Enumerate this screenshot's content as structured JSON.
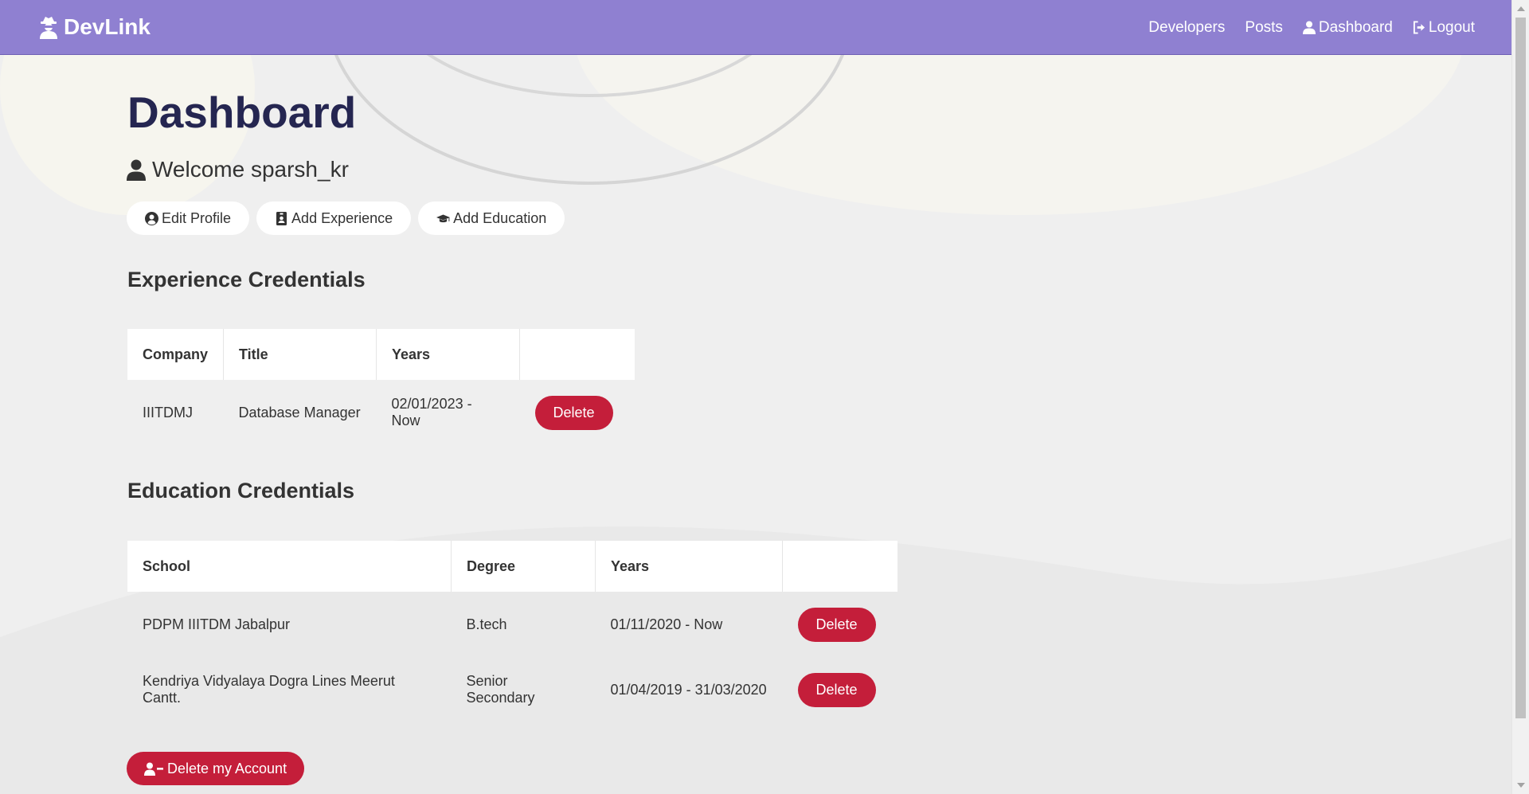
{
  "colors": {
    "navbar": "#8f80d1",
    "title": "#252651",
    "danger": "#c41e3a",
    "background": "#f1f1f1"
  },
  "navbar": {
    "brand": "DevLink",
    "brand_icon": "user-secret-icon",
    "links": [
      {
        "label": "Developers"
      },
      {
        "label": "Posts"
      },
      {
        "label": "Dashboard",
        "icon": "user-icon"
      },
      {
        "label": "Logout",
        "icon": "sign-out-icon"
      }
    ]
  },
  "page": {
    "title": "Dashboard",
    "welcome": "Welcome sparsh_kr",
    "actions": [
      {
        "label": "Edit Profile",
        "icon": "user-circle-icon"
      },
      {
        "label": "Add Experience",
        "icon": "id-badge-icon"
      },
      {
        "label": "Add Education",
        "icon": "graduation-cap-icon"
      }
    ]
  },
  "experience": {
    "heading": "Experience Credentials",
    "columns": [
      "Company",
      "Title",
      "Years",
      ""
    ],
    "rows": [
      {
        "company": "IIITDMJ",
        "title": "Database Manager",
        "years": "02/01/2023 - Now",
        "action": "Delete"
      }
    ]
  },
  "education": {
    "heading": "Education Credentials",
    "columns": [
      "School",
      "Degree",
      "Years",
      ""
    ],
    "rows": [
      {
        "school": "PDPM IIITDM Jabalpur",
        "degree": "B.tech",
        "years": "01/11/2020 - Now",
        "action": "Delete"
      },
      {
        "school": "Kendriya Vidyalaya Dogra Lines Meerut Cantt.",
        "degree": "Senior Secondary",
        "years": "01/04/2019 - 31/03/2020",
        "action": "Delete"
      }
    ]
  },
  "delete_account": {
    "label": "Delete my Account",
    "icon": "user-minus-icon"
  }
}
